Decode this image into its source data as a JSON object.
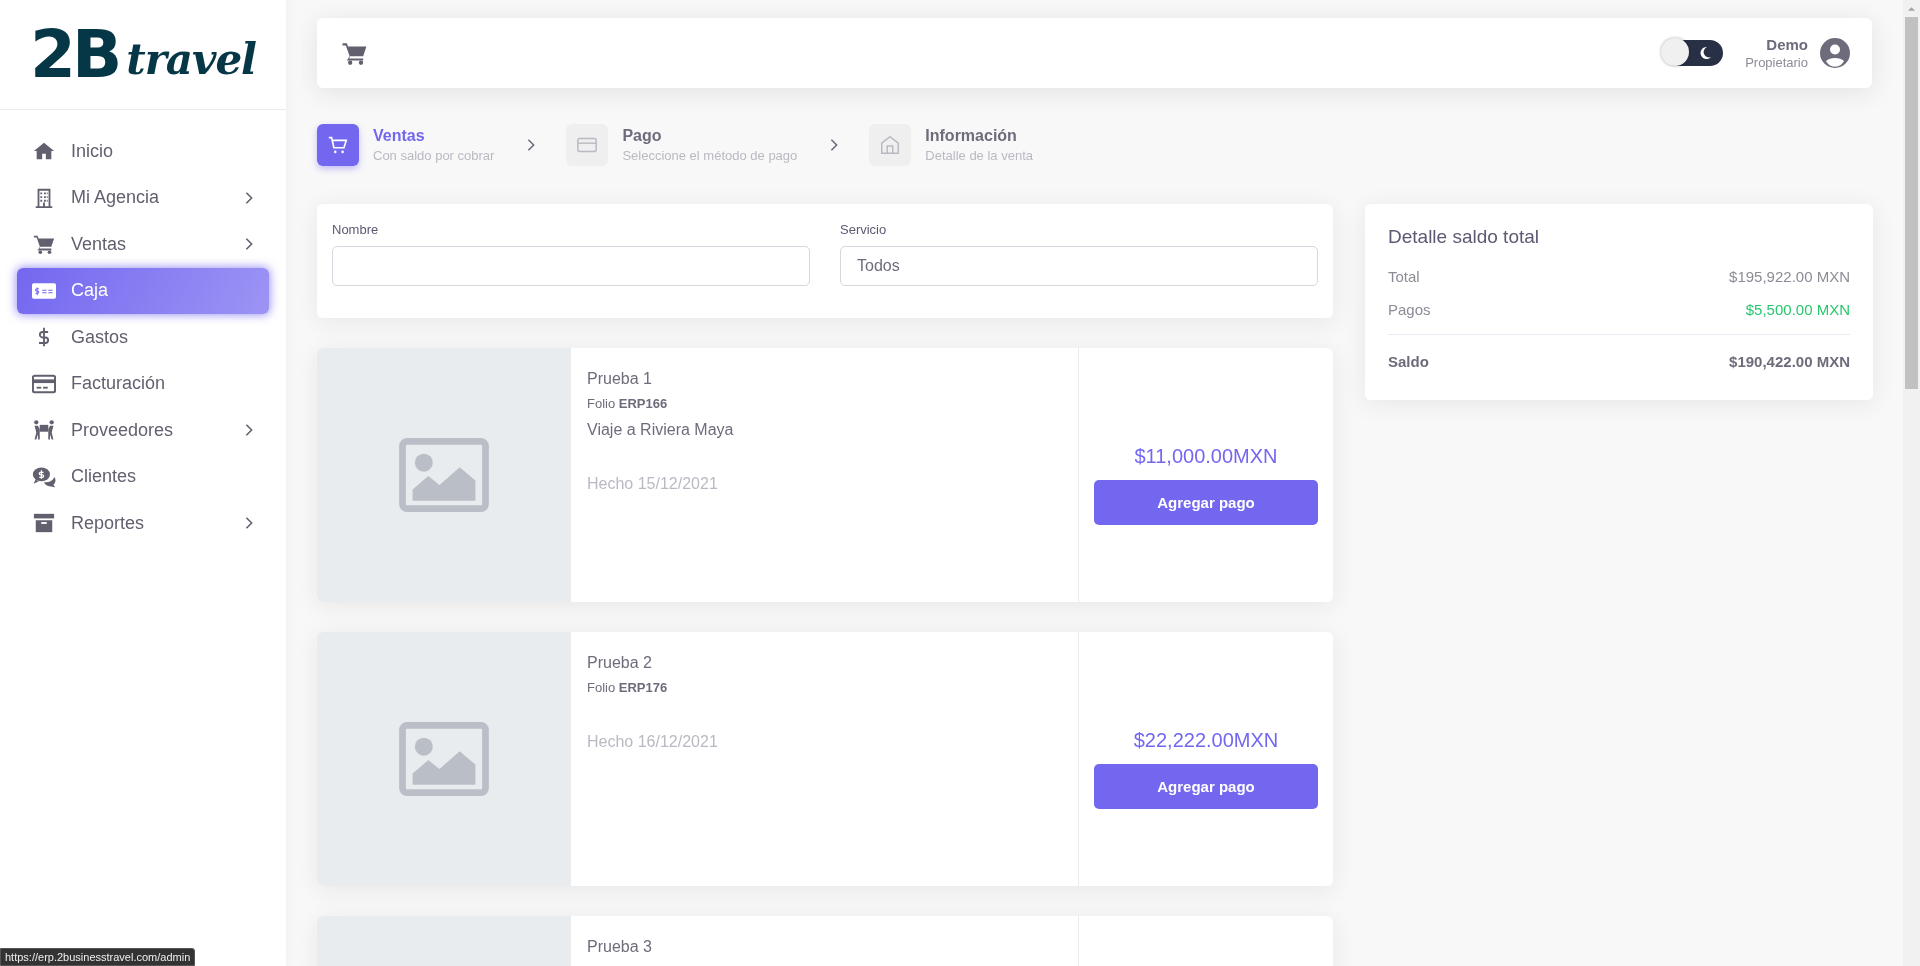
{
  "logo": {
    "mark": "2B",
    "word": "travel"
  },
  "sidebar": {
    "items": [
      {
        "label": "Inicio",
        "selected": false,
        "submenu": false
      },
      {
        "label": "Mi Agencia",
        "selected": false,
        "submenu": true
      },
      {
        "label": "Ventas",
        "selected": false,
        "submenu": true
      },
      {
        "label": "Caja",
        "selected": true,
        "submenu": false
      },
      {
        "label": "Gastos",
        "selected": false,
        "submenu": false
      },
      {
        "label": "Facturación",
        "selected": false,
        "submenu": false
      },
      {
        "label": "Proveedores",
        "selected": false,
        "submenu": true
      },
      {
        "label": "Clientes",
        "selected": false,
        "submenu": false
      },
      {
        "label": "Reportes",
        "selected": false,
        "submenu": true
      }
    ]
  },
  "header": {
    "dark_mode": {
      "on": false
    },
    "user": {
      "name": "Demo",
      "role": "Propietario"
    }
  },
  "steps": [
    {
      "title": "Ventas",
      "subtitle": "Con saldo por cobrar",
      "selected": true
    },
    {
      "title": "Pago",
      "subtitle": "Seleccione el método de pago",
      "selected": false
    },
    {
      "title": "Información",
      "subtitle": "Detalle de la venta",
      "selected": false
    }
  ],
  "filters": [
    {
      "label": "Nombre"
    },
    {
      "label": "Servicio",
      "value": "Todos"
    }
  ],
  "sales": [
    {
      "title": "Prueba 1",
      "folio": "Folio **ERP166**",
      "description": "Viaje a Riviera Maya",
      "date": "Hecho 15/12/2021",
      "price": "$11,000.00MXN",
      "button": "Agregar pago"
    },
    {
      "title": "Prueba 2",
      "folio": "Folio **ERP176**",
      "date": "Hecho 16/12/2021",
      "price": "$22,222.00MXN",
      "button": "Agregar pago"
    },
    {
      "title": "Prueba 3"
    }
  ],
  "summary": {
    "title": "Detalle saldo total",
    "rows": [
      {
        "label": "Total",
        "value": "$195,922.00 MXN",
        "kind": "plain"
      },
      {
        "label": "Pagos",
        "value": "$5,500.00 MXN",
        "kind": "paid"
      },
      {
        "label": "Saldo",
        "value": "$190,422.00 MXN",
        "kind": "total"
      }
    ]
  },
  "status_url": "https://erp.2businesstravel.com/admin"
}
